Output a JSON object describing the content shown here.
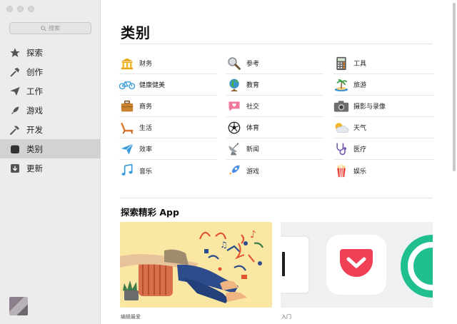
{
  "sidebar": {
    "search_placeholder": "搜索",
    "items": [
      {
        "label": "探索",
        "icon": "star-icon"
      },
      {
        "label": "创作",
        "icon": "hammer-brush-icon"
      },
      {
        "label": "工作",
        "icon": "paper-plane-icon"
      },
      {
        "label": "游戏",
        "icon": "rocket-icon"
      },
      {
        "label": "开发",
        "icon": "hammer-icon"
      },
      {
        "label": "类别",
        "icon": "box-icon",
        "active": true
      },
      {
        "label": "更新",
        "icon": "download-icon"
      }
    ]
  },
  "main": {
    "title": "类别",
    "categories": [
      {
        "label": "财务",
        "icon": "bank-icon"
      },
      {
        "label": "参考",
        "icon": "magnifier-icon"
      },
      {
        "label": "工具",
        "icon": "calculator-icon"
      },
      {
        "label": "健康健美",
        "icon": "bicycle-icon"
      },
      {
        "label": "教育",
        "icon": "globe-icon"
      },
      {
        "label": "旅游",
        "icon": "palm-island-icon"
      },
      {
        "label": "商务",
        "icon": "briefcase-icon"
      },
      {
        "label": "社交",
        "icon": "chat-heart-icon"
      },
      {
        "label": "摄影与录像",
        "icon": "camera-icon"
      },
      {
        "label": "生活",
        "icon": "lounge-chair-icon"
      },
      {
        "label": "体育",
        "icon": "soccer-ball-icon"
      },
      {
        "label": "天气",
        "icon": "sun-cloud-icon"
      },
      {
        "label": "效率",
        "icon": "paper-plane-icon"
      },
      {
        "label": "新闻",
        "icon": "satellite-dish-icon"
      },
      {
        "label": "医疗",
        "icon": "stethoscope-icon"
      },
      {
        "label": "音乐",
        "icon": "music-notes-icon"
      },
      {
        "label": "游戏",
        "icon": "rocket-icon"
      },
      {
        "label": "娱乐",
        "icon": "popcorn-icon"
      }
    ],
    "section_title": "探索精彩 App",
    "cards": [
      {
        "label": "编辑最爱"
      },
      {
        "label": "入门"
      }
    ]
  },
  "colors": {
    "sidebar_bg": "#ececec",
    "sidebar_active": "#d2d2d2",
    "pocket_red": "#ef4056",
    "teal": "#1fbf8f",
    "card_yellow": "#fbe7a4"
  }
}
